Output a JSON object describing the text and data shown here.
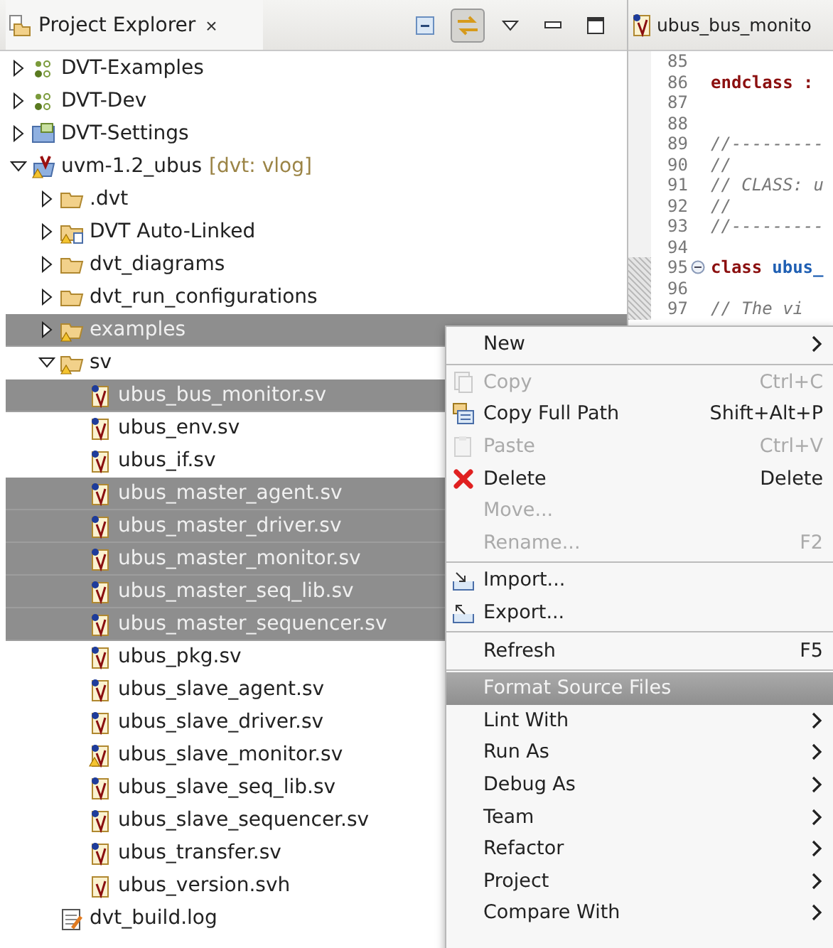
{
  "explorer": {
    "title": "Project Explorer",
    "close": "×",
    "toolbar": [
      {
        "kind": "collapse",
        "on": false
      },
      {
        "kind": "link",
        "on": true
      },
      {
        "kind": "viewmenu",
        "on": false
      },
      {
        "kind": "minimize",
        "on": false
      },
      {
        "kind": "maximize",
        "on": false
      }
    ],
    "tree": [
      {
        "label": "DVT-Examples",
        "kind": "project",
        "expanded": false,
        "selected": false,
        "warning": false
      },
      {
        "label": "DVT-Dev",
        "kind": "project",
        "expanded": false,
        "selected": false,
        "warning": false
      },
      {
        "label": "DVT-Settings",
        "kind": "settings",
        "expanded": false,
        "selected": false,
        "warning": false
      },
      {
        "label": "uvm-1.2_ubus",
        "suffix": "[dvt: vlog]",
        "kind": "vproject",
        "expanded": true,
        "selected": false,
        "warning": true,
        "children": [
          {
            "label": ".dvt",
            "kind": "folder",
            "expanded": false,
            "selected": false,
            "warning": false
          },
          {
            "label": "DVT Auto-Linked",
            "kind": "linked",
            "expanded": false,
            "selected": false,
            "warning": true
          },
          {
            "label": "dvt_diagrams",
            "kind": "folder",
            "expanded": false,
            "selected": false,
            "warning": false
          },
          {
            "label": "dvt_run_configurations",
            "kind": "folder",
            "expanded": false,
            "selected": false,
            "warning": false
          },
          {
            "label": "examples",
            "kind": "folder",
            "expanded": false,
            "selected": true,
            "warning": true
          },
          {
            "label": "sv",
            "kind": "folder",
            "expanded": true,
            "selected": false,
            "warning": true,
            "children": [
              {
                "label": "ubus_bus_monitor.sv",
                "kind": "sv",
                "selected": true,
                "warning": false
              },
              {
                "label": "ubus_env.sv",
                "kind": "sv",
                "selected": false,
                "warning": false
              },
              {
                "label": "ubus_if.sv",
                "kind": "sv",
                "selected": false,
                "warning": false
              },
              {
                "label": "ubus_master_agent.sv",
                "kind": "sv",
                "selected": true,
                "warning": false
              },
              {
                "label": "ubus_master_driver.sv",
                "kind": "sv",
                "selected": true,
                "warning": false
              },
              {
                "label": "ubus_master_monitor.sv",
                "kind": "sv",
                "selected": true,
                "warning": false
              },
              {
                "label": "ubus_master_seq_lib.sv",
                "kind": "sv",
                "selected": true,
                "warning": false
              },
              {
                "label": "ubus_master_sequencer.sv",
                "kind": "sv",
                "selected": true,
                "warning": false
              },
              {
                "label": "ubus_pkg.sv",
                "kind": "sv",
                "selected": false,
                "warning": false
              },
              {
                "label": "ubus_slave_agent.sv",
                "kind": "sv",
                "selected": false,
                "warning": false
              },
              {
                "label": "ubus_slave_driver.sv",
                "kind": "sv",
                "selected": false,
                "warning": false
              },
              {
                "label": "ubus_slave_monitor.sv",
                "kind": "sv",
                "selected": false,
                "warning": true
              },
              {
                "label": "ubus_slave_seq_lib.sv",
                "kind": "sv",
                "selected": false,
                "warning": false
              },
              {
                "label": "ubus_slave_sequencer.sv",
                "kind": "sv",
                "selected": false,
                "warning": false
              },
              {
                "label": "ubus_transfer.sv",
                "kind": "sv",
                "selected": false,
                "warning": false
              },
              {
                "label": "ubus_version.svh",
                "kind": "svh",
                "selected": false,
                "warning": false
              }
            ]
          },
          {
            "label": "dvt_build.log",
            "kind": "log",
            "selected": false,
            "warning": false
          }
        ]
      }
    ]
  },
  "editor": {
    "tab": "ubus_bus_monito",
    "lines": [
      {
        "number": "85",
        "kind": "plain"
      },
      {
        "number": "86",
        "code": "endclass :",
        "kind": "keyword"
      },
      {
        "number": "87",
        "kind": "plain"
      },
      {
        "number": "88",
        "kind": "plain"
      },
      {
        "number": "89",
        "code": "//---------",
        "kind": "comment"
      },
      {
        "number": "90",
        "code": "//",
        "kind": "comment"
      },
      {
        "number": "91",
        "code": "// CLASS: u",
        "kind": "comment"
      },
      {
        "number": "92",
        "code": "//",
        "kind": "comment"
      },
      {
        "number": "93",
        "code": "//---------",
        "kind": "comment"
      },
      {
        "number": "94",
        "kind": "plain"
      },
      {
        "number": "95",
        "code": "class",
        "name": "ubus_",
        "kind": "class",
        "folded": false
      },
      {
        "number": "96",
        "kind": "plain"
      },
      {
        "number": "97",
        "code": "  // The vi",
        "kind": "comment"
      }
    ]
  },
  "context_menu": [
    {
      "kind": "plain",
      "label": "New",
      "submenu": true,
      "disabled": false,
      "selected": false
    },
    {
      "kind": "separator"
    },
    {
      "kind": "copy",
      "label": "Copy",
      "shortcut": "Ctrl+C",
      "disabled": true,
      "selected": false
    },
    {
      "kind": "path",
      "label": "Copy Full Path",
      "shortcut": "Shift+Alt+P",
      "disabled": false,
      "selected": false
    },
    {
      "kind": "paste",
      "label": "Paste",
      "shortcut": "Ctrl+V",
      "disabled": true,
      "selected": false
    },
    {
      "kind": "delete",
      "label": "Delete",
      "shortcut": "Delete",
      "disabled": false,
      "selected": false
    },
    {
      "kind": "plain",
      "label": "Move...",
      "disabled": true,
      "selected": false
    },
    {
      "kind": "plain",
      "label": "Rename...",
      "shortcut": "F2",
      "disabled": true,
      "selected": false
    },
    {
      "kind": "separator"
    },
    {
      "kind": "import",
      "label": "Import...",
      "disabled": false,
      "selected": false
    },
    {
      "kind": "export",
      "label": "Export...",
      "disabled": false,
      "selected": false
    },
    {
      "kind": "separator"
    },
    {
      "kind": "plain",
      "label": "Refresh",
      "shortcut": "F5",
      "disabled": false,
      "selected": false
    },
    {
      "kind": "separator"
    },
    {
      "kind": "plain",
      "label": "Format Source Files",
      "disabled": false,
      "selected": true
    },
    {
      "kind": "plain",
      "label": "Lint With",
      "submenu": true,
      "disabled": false,
      "selected": false
    },
    {
      "kind": "plain",
      "label": "Run As",
      "submenu": true,
      "disabled": false,
      "selected": false
    },
    {
      "kind": "plain",
      "label": "Debug As",
      "submenu": true,
      "disabled": false,
      "selected": false
    },
    {
      "kind": "plain",
      "label": "Team",
      "submenu": true,
      "disabled": false,
      "selected": false
    },
    {
      "kind": "plain",
      "label": "Refactor",
      "submenu": true,
      "disabled": false,
      "selected": false
    },
    {
      "kind": "plain",
      "label": "Project",
      "submenu": true,
      "disabled": false,
      "selected": false
    },
    {
      "kind": "plain",
      "label": "Compare With",
      "submenu": true,
      "disabled": false,
      "selected": false
    }
  ]
}
